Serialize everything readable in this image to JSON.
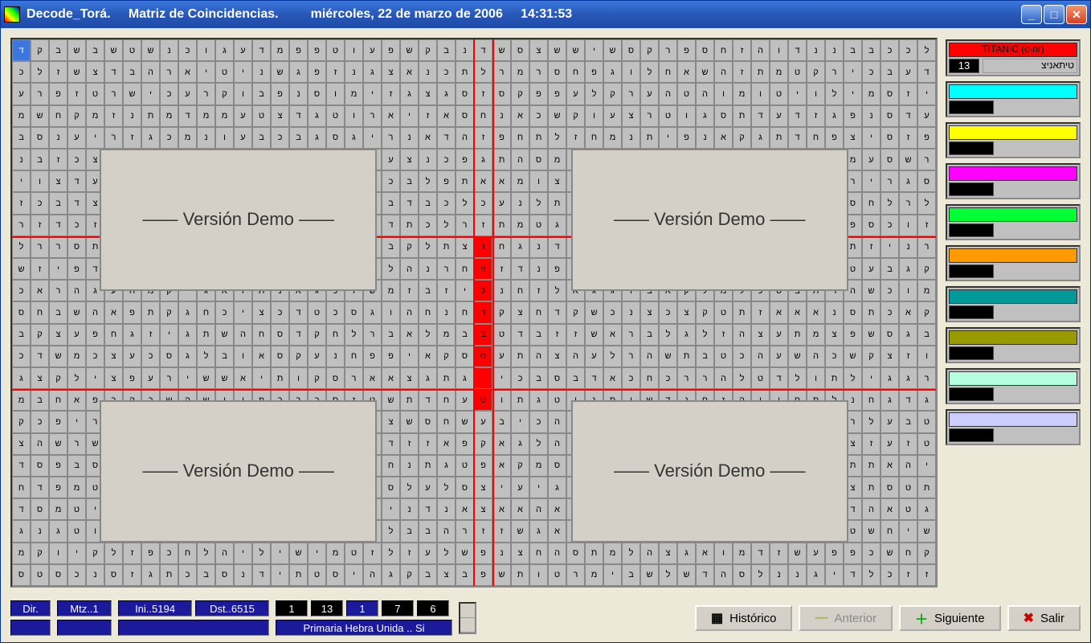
{
  "title": {
    "app": "Decode_Torá.",
    "section": "Matriz de Coincidencias.",
    "date": "miércoles, 22 de marzo de 2006",
    "time": "14:31:53"
  },
  "demo_label": "——  Versión Demo  ——",
  "hebrew_alphabet": [
    "א",
    "ב",
    "ג",
    "ד",
    "ה",
    "ו",
    "ז",
    "ח",
    "ט",
    "י",
    "כ",
    "ל",
    "מ",
    "נ",
    "ס",
    "ע",
    "פ",
    "צ",
    "ק",
    "ר",
    "ש",
    "ת"
  ],
  "sidebar": {
    "items": [
      {
        "color": "#ff0000",
        "label": "TITANIC (c-nr)",
        "num": "13",
        "hebrew": "טיתאניצ",
        "show_text": true
      },
      {
        "color": "#00ffff"
      },
      {
        "color": "#ffff00"
      },
      {
        "color": "#ff00ff"
      },
      {
        "color": "#00ff33"
      },
      {
        "color": "#ff9900"
      },
      {
        "color": "#009999"
      },
      {
        "color": "#999900"
      },
      {
        "color": "#b3ffdd"
      },
      {
        "color": "#ccccff"
      }
    ]
  },
  "status": {
    "dir": "Dir.",
    "mtz": "Mtz..1",
    "ini": "Ini..5194",
    "dst": "Dst..6515",
    "v1": "1",
    "v2": "13",
    "v3": "1",
    "v4": "7",
    "v5": "6",
    "primaria": "Primaria Hebra Unida .. Si"
  },
  "buttons": {
    "historico": "Histórico",
    "anterior": "Anterior",
    "siguiente": "Siguiente",
    "salir": "Salir"
  }
}
